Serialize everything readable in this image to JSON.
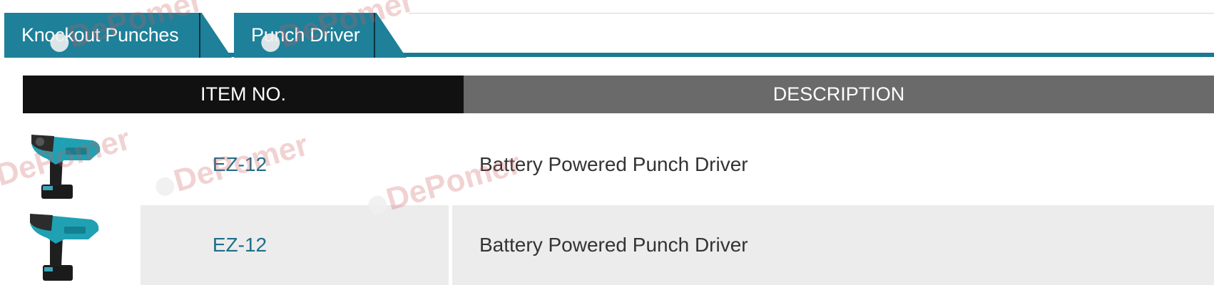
{
  "tabs": [
    {
      "label": "Knockout Punches"
    },
    {
      "label": "Punch Driver"
    }
  ],
  "table": {
    "headers": {
      "item_no": "ITEM NO.",
      "description": "DESCRIPTION"
    },
    "rows": [
      {
        "item_no": "EZ-12",
        "description": "Battery Powered Punch Driver",
        "image": "punch-driver-tool"
      },
      {
        "item_no": "EZ-12",
        "description": "Battery Powered Punch Driver",
        "image": "punch-driver-tool"
      }
    ]
  },
  "watermark": {
    "text": "DePomer"
  },
  "colors": {
    "tab": "#1e8099",
    "tab_line": "#1a7a92",
    "header_item": "#111111",
    "header_desc": "#6a6a6a",
    "link": "#1e6e88",
    "row_alt": "#ececec"
  }
}
